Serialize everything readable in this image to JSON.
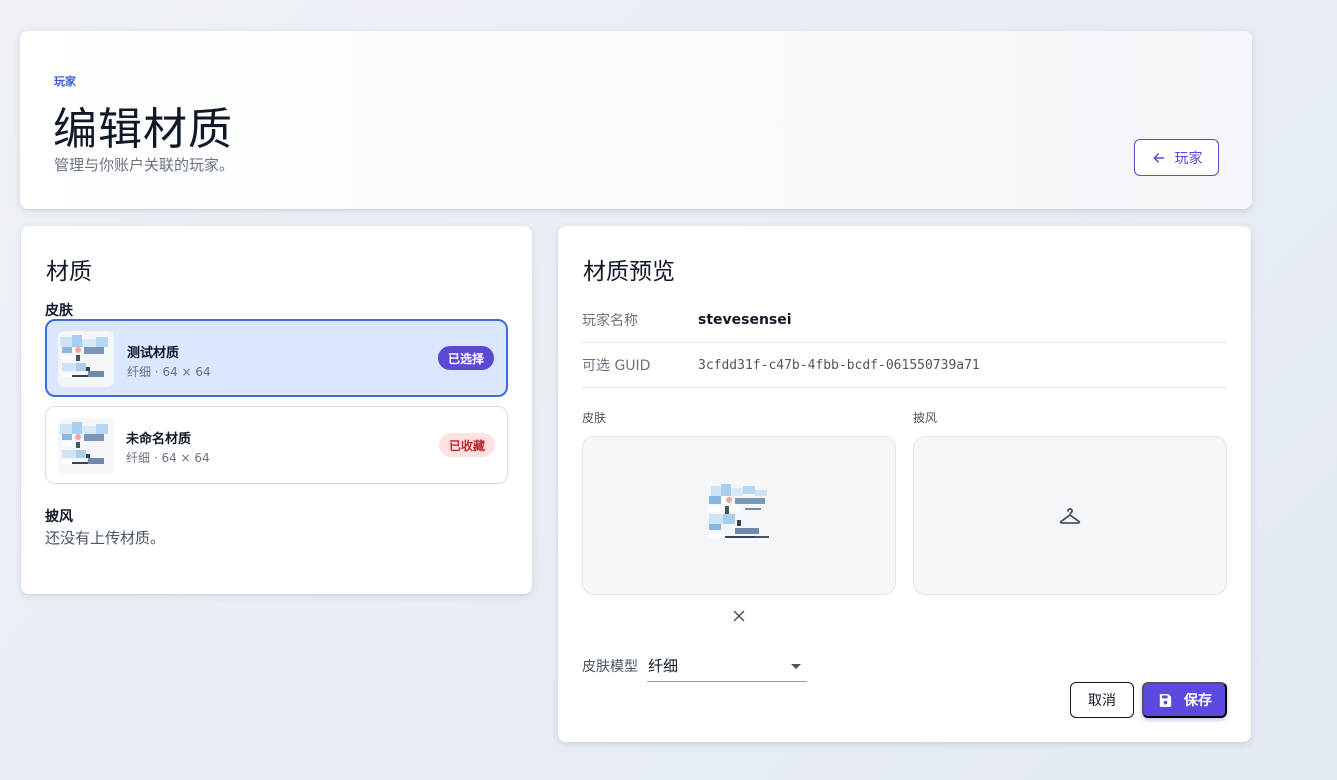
{
  "header": {
    "eyebrow": "玩家",
    "title": "编辑材质",
    "subtitle": "管理与你账户关联的玩家。",
    "back_label": "玩家"
  },
  "textures": {
    "title": "材质",
    "skin_section": "皮肤",
    "items": [
      {
        "name": "测试材质",
        "meta": "纤细 · 64 × 64",
        "badge": "已选择",
        "selected": true
      },
      {
        "name": "未命名材质",
        "meta": "纤细 · 64 × 64",
        "badge": "已收藏",
        "selected": false
      }
    ],
    "cape_section": "披风",
    "cape_empty": "还没有上传材质。"
  },
  "preview": {
    "title": "材质预览",
    "player_name_label": "玩家名称",
    "player_name": "stevesensei",
    "guid_label": "可选 GUID",
    "guid": "3cfdd31f-c47b-4fbb-bcdf-061550739a71",
    "skin_label": "皮肤",
    "cape_label": "披风",
    "model_label": "皮肤模型",
    "model_value": "纤细",
    "cancel_label": "取消",
    "save_label": "保存"
  },
  "icons": {
    "back": "arrow-left-icon",
    "clear": "close-icon",
    "cape_placeholder": "hanger-icon",
    "save": "floppy-disk-icon",
    "dropdown": "caret-down-icon"
  },
  "colors": {
    "accent": "#5b49d6",
    "selected_border": "#3b6fd8",
    "selected_bg": "#dbe7ff",
    "fav_bg": "#fde2e2",
    "fav_text": "#c0262d"
  }
}
